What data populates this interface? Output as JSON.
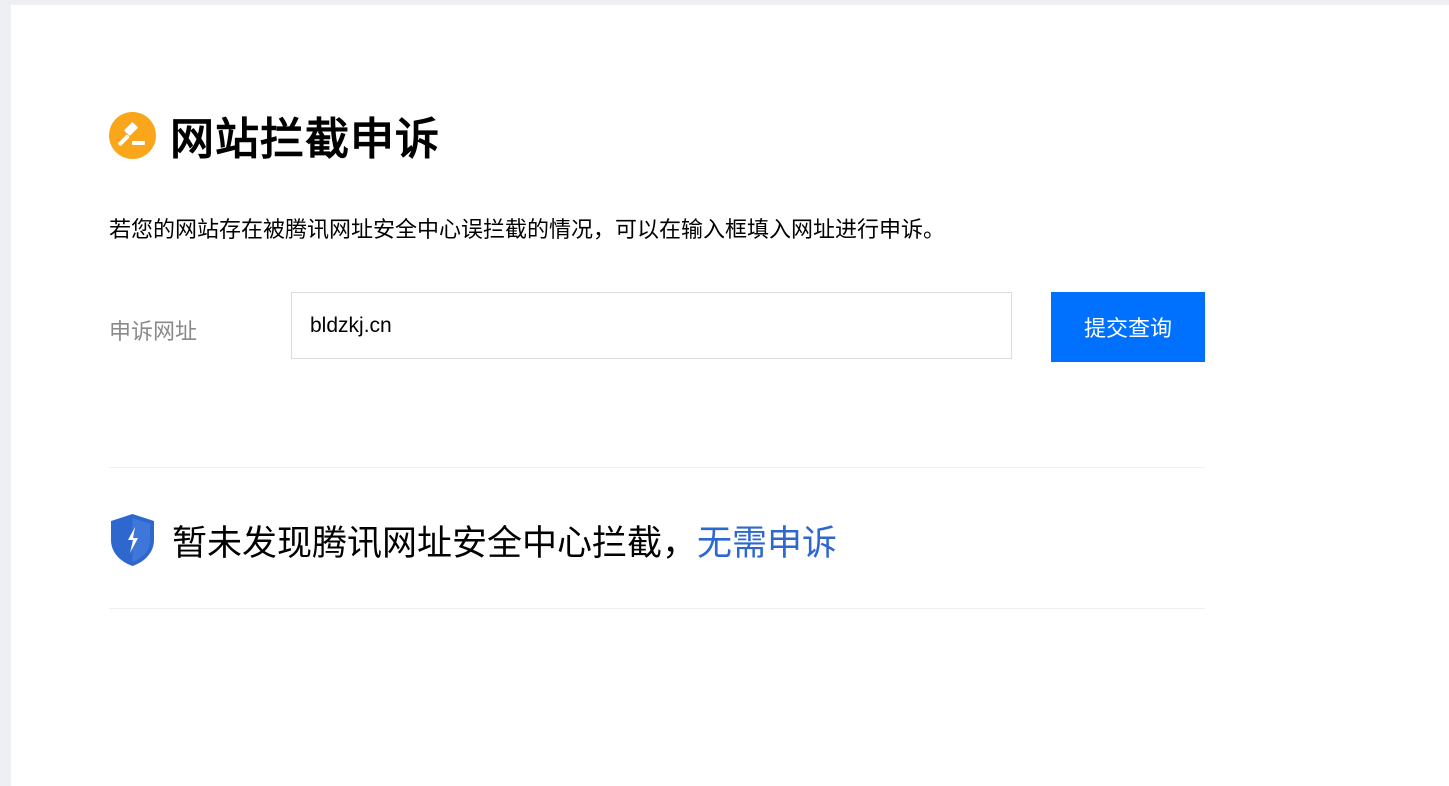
{
  "header": {
    "title": "网站拦截申诉",
    "title_icon": "gavel-icon",
    "icon_color": "#f9a61a"
  },
  "description": "若您的网站存在被腾讯网址安全中心误拦截的情况，可以在输入框填入网址进行申诉。",
  "form": {
    "label": "申诉网址",
    "url_value": "bldzkj.cn",
    "submit_label": "提交查询",
    "submit_color": "#0070ff"
  },
  "result": {
    "icon": "shield-icon",
    "message": "暂未发现腾讯网址安全中心拦截，",
    "link_text": "无需申诉",
    "link_color": "#2e68cf"
  }
}
